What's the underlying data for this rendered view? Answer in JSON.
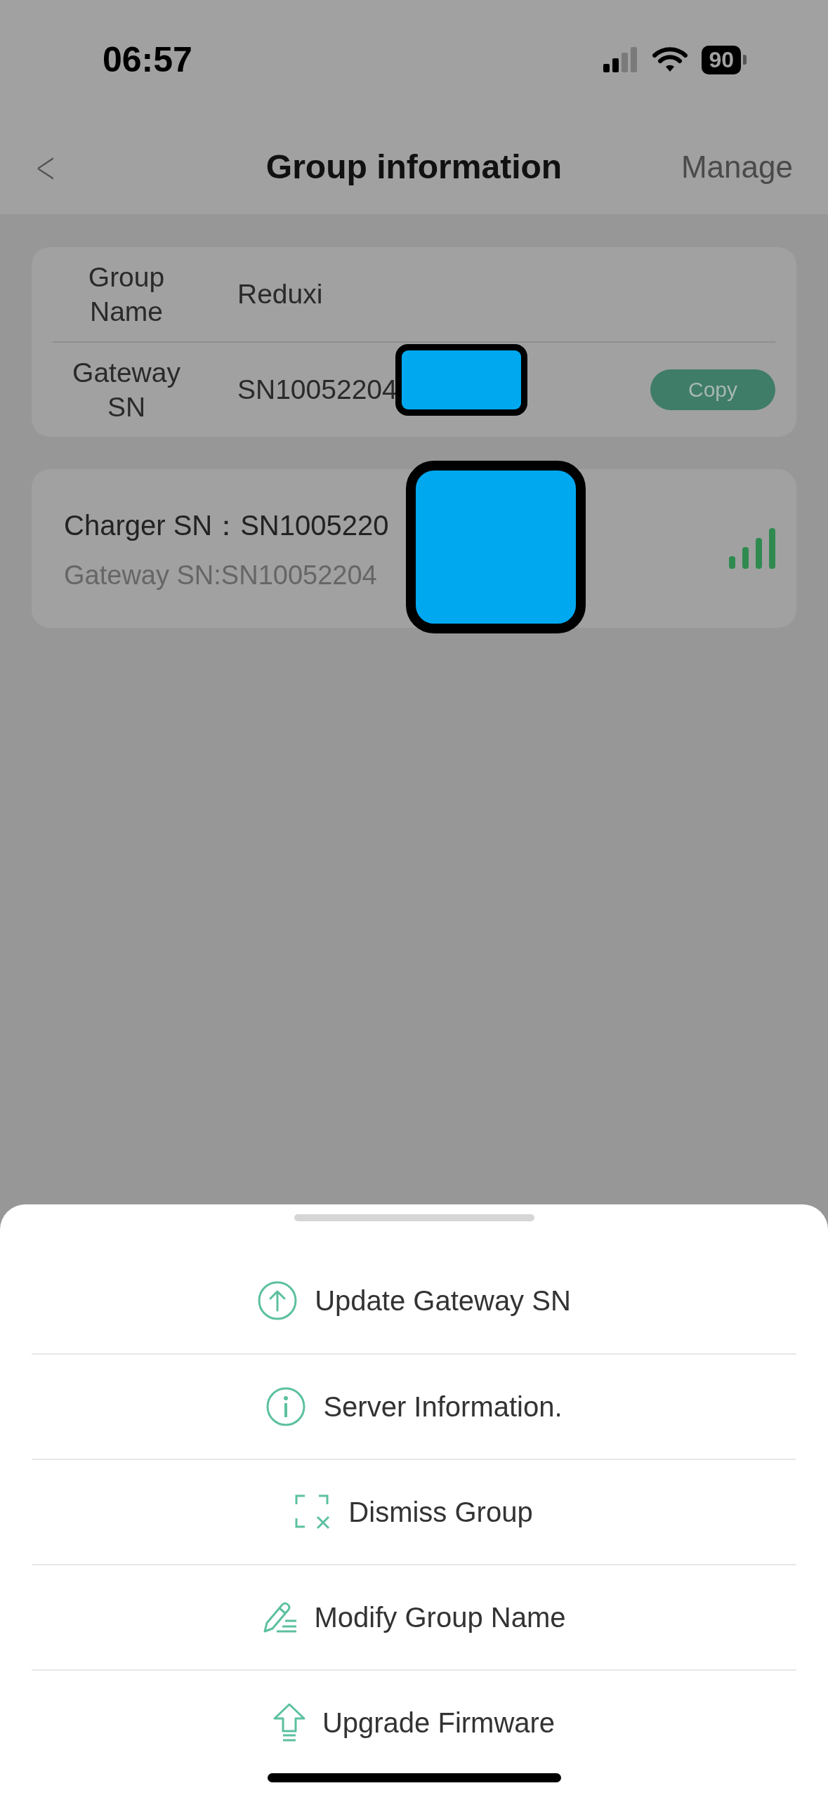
{
  "status_bar": {
    "time": "06:57",
    "battery": "90"
  },
  "nav": {
    "back": "<",
    "title": "Group information",
    "action": "Manage"
  },
  "group_card": {
    "rows": [
      {
        "label": "Group Name",
        "value": "Reduxi"
      },
      {
        "label": "Gateway SN",
        "value": "SN10052204",
        "button": "Copy"
      }
    ]
  },
  "charger_card": {
    "title": "Charger SN：SN1005220",
    "subtitle": "Gateway SN:SN10052204"
  },
  "action_sheet": {
    "items": [
      {
        "kind": "update",
        "label": "Update Gateway SN"
      },
      {
        "kind": "info",
        "label": "Server Information."
      },
      {
        "kind": "dismiss",
        "label": "Dismiss Group"
      },
      {
        "kind": "edit",
        "label": "Modify Group Name"
      },
      {
        "kind": "upgrade",
        "label": "Upgrade Firmware"
      }
    ]
  }
}
